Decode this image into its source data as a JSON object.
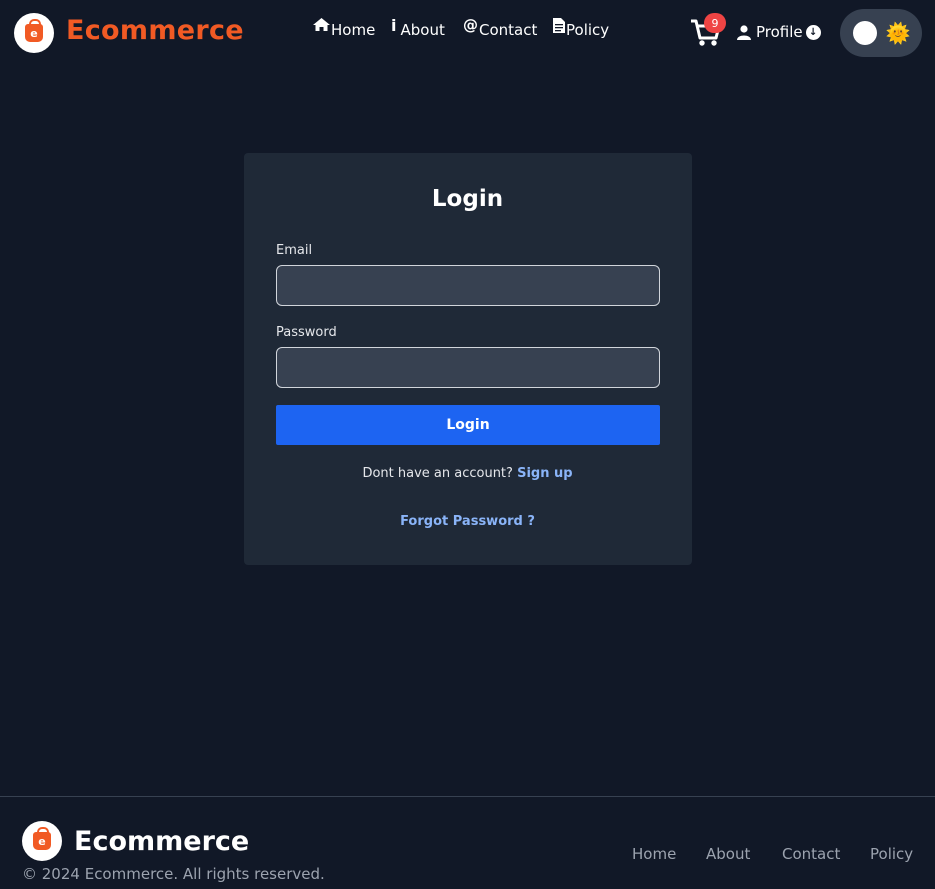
{
  "header": {
    "brand": "Ecommerce",
    "logo_letter": "e",
    "nav": [
      {
        "label": "Home",
        "icon": "home-icon"
      },
      {
        "label": "About",
        "icon": "info-icon"
      },
      {
        "label": "Contact",
        "icon": "at-icon"
      },
      {
        "label": "Policy",
        "icon": "document-icon"
      }
    ],
    "cart_count": "9",
    "profile_label": "Profile",
    "theme_icon": "sun-icon"
  },
  "login": {
    "title": "Login",
    "email_label": "Email",
    "email_value": "",
    "password_label": "Password",
    "password_value": "",
    "button_label": "Login",
    "no_account_text": "Dont have an account?",
    "signup_link": "Sign up",
    "forgot_link": "Forgot Password ?"
  },
  "footer": {
    "brand": "Ecommerce",
    "copyright": "© 2024 Ecommerce. All rights reserved.",
    "links": [
      "Home",
      "About",
      "Contact",
      "Policy"
    ]
  },
  "colors": {
    "background": "#111827",
    "card": "#1f2937",
    "brand_orange": "#f15a24",
    "primary_blue": "#1d64f2",
    "link_blue": "#8ab4f8",
    "badge_red": "#ef4444"
  }
}
